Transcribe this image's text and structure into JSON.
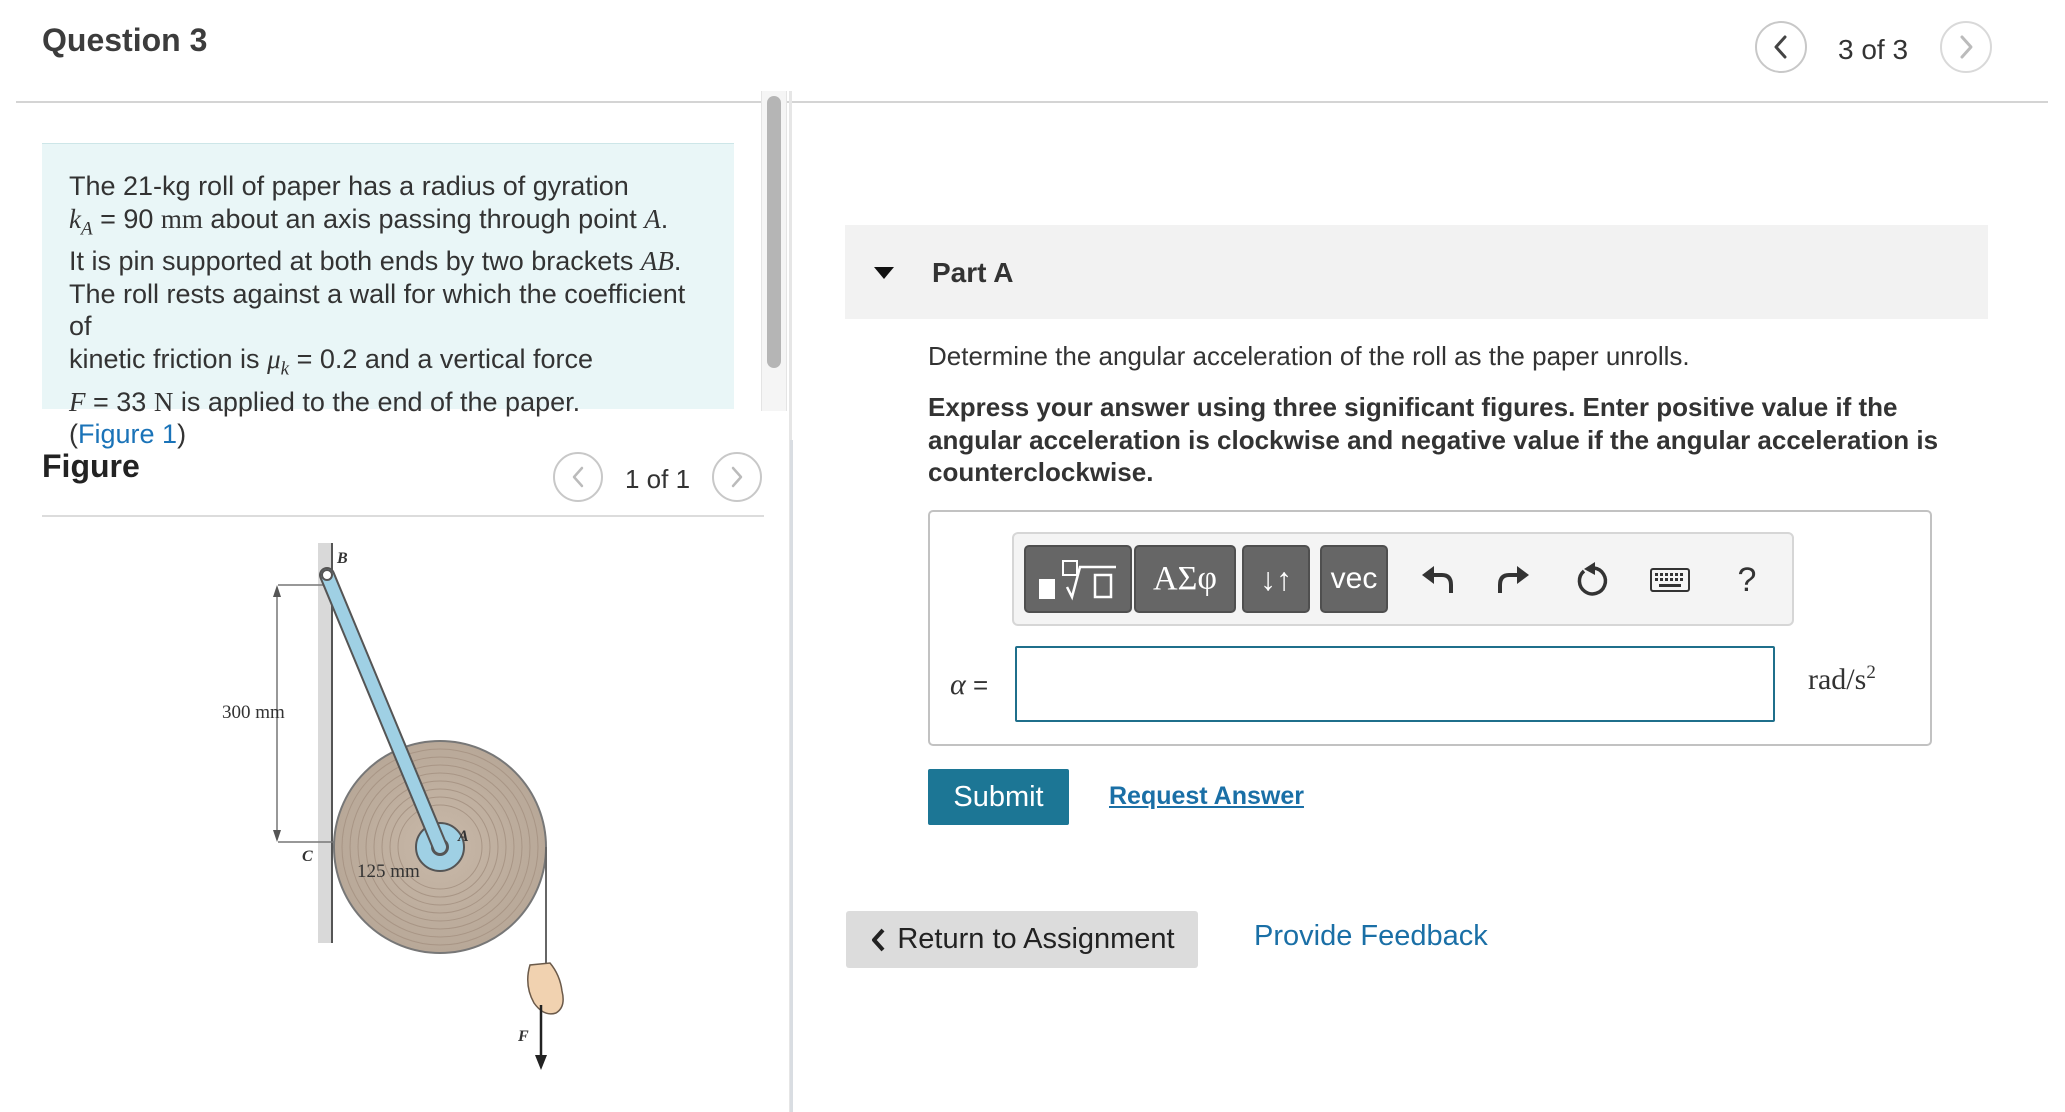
{
  "header": {
    "question_title": "Question 3",
    "counter": "3 of 3",
    "prev_icon": "chevron-left-icon",
    "next_icon": "chevron-right-icon"
  },
  "problem": {
    "line1": "The 21-kg roll of paper has a radius of gyration",
    "line2_sym": "k",
    "line2_sub": "A",
    "line2_eq": " = 90 ",
    "line2_unit": "mm",
    "line2_rest": " about an axis passing through point ",
    "line2_point": "A",
    "line2_end": ".",
    "line3_pre": "It is pin supported at both ends by two brackets ",
    "line3_sym": "AB",
    "line3_end": ".",
    "line4": "The roll rests against a wall for which the coefficient of",
    "line5_pre": "kinetic friction is ",
    "line5_sym": "μ",
    "line5_sub": "k",
    "line5_rest": " = 0.2 and a vertical force",
    "line6_sym": "F",
    "line6_eq": " = 33 ",
    "line6_unit": "N",
    "line6_rest": " is applied to the end of the paper.",
    "fig_open": "(",
    "fig_link": "Figure 1",
    "fig_close": ")"
  },
  "figure": {
    "title": "Figure",
    "counter": "1 of 1",
    "labels": {
      "B": "B",
      "C": "C",
      "A": "A",
      "F": "F",
      "dim1": "300 mm",
      "dim2": "125 mm"
    }
  },
  "part": {
    "title": "Part A",
    "question": "Determine the angular acceleration of the roll as the paper unrolls.",
    "instructions": "Express your answer using three significant figures. Enter positive value if the angular acceleration is clockwise and negative value if the angular acceleration is counterclockwise."
  },
  "toolbar": {
    "greek_label": "ΑΣφ",
    "arrows_label": "↓↑",
    "vec_label": "vec",
    "help_label": "?",
    "icons": [
      "templates-icon",
      "undo-icon",
      "redo-icon",
      "reset-icon",
      "keyboard-icon"
    ]
  },
  "answer": {
    "variable": "α",
    "equals": " =",
    "value": "",
    "unit_base": "rad/s",
    "unit_exp": "2"
  },
  "actions": {
    "submit": "Submit",
    "request_answer": "Request Answer",
    "return": "Return to Assignment",
    "feedback": "Provide Feedback"
  },
  "colors": {
    "accent": "#1c7695",
    "link": "#1a6fa6",
    "problem_bg": "#e9f6f7"
  }
}
